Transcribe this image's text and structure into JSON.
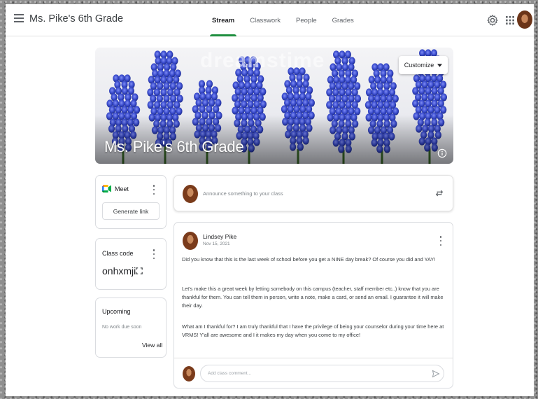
{
  "header": {
    "menu_icon": "hamburger-menu-icon",
    "class_title": "Ms. Pike's 6th Grade",
    "tabs": [
      {
        "label": "Stream",
        "active": true
      },
      {
        "label": "Classwork",
        "active": false
      },
      {
        "label": "People",
        "active": false
      },
      {
        "label": "Grades",
        "active": false
      }
    ],
    "settings_icon": "gear-icon",
    "apps_icon": "apps-grid-icon",
    "accent_color": "#1e8e3e"
  },
  "banner": {
    "title": "Ms. Pike's 6th Grade",
    "customize_label": "Customize",
    "watermark": "dreamstime",
    "info_icon": "info-icon",
    "flower_color": "#3d4fd0"
  },
  "meet": {
    "label": "Meet",
    "icon": "google-meet-icon",
    "button_label": "Generate link"
  },
  "class_code": {
    "label": "Class code",
    "value": "onhxmji",
    "icon": "fullscreen-icon"
  },
  "upcoming": {
    "label": "Upcoming",
    "empty_text": "No work due soon",
    "view_all_label": "View all"
  },
  "announce": {
    "placeholder": "Announce something to your class",
    "icon": "repost-icon"
  },
  "post": {
    "author": "Lindsey Pike",
    "date": "Nov 15, 2021",
    "paragraphs": [
      "Did you know that this is the last week of school before you get a NINE day break?  Of course you did and YAY!",
      "Let's make this a great week by letting somebody on this campus (teacher, staff member etc..) know that you are thankful for them. You can tell them in person, write a note, make a card, or send an email. I guarantee it will make their day.",
      "What am I thankful for? I am truly thankful that I have the privilege of being your counselor during your time here at VRMS! Y'all are awesome and I it makes my day when you come to my office!"
    ],
    "comment_placeholder": "Add class comment...",
    "send_icon": "send-icon"
  }
}
